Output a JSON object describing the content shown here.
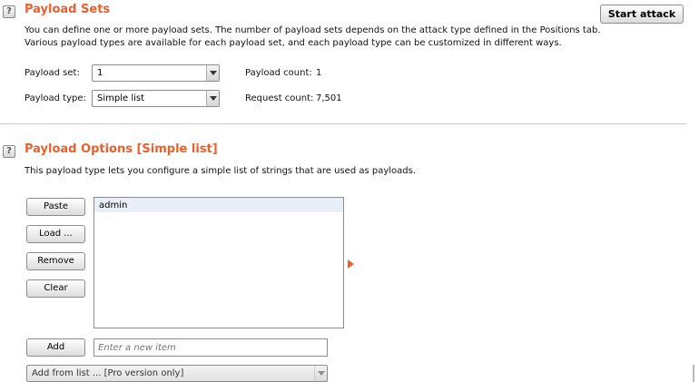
{
  "payload_sets": {
    "title": "Payload Sets",
    "start_attack_label": "Start attack",
    "description_line1": "You can define one or more payload sets. The number of payload sets depends on the attack type defined in the Positions tab.",
    "description_line2": "Various payload types are available for each payload set, and each payload type can be customized in different ways.",
    "payload_set_label": "Payload set:",
    "payload_set_value": "1",
    "payload_count_label": "Payload count:",
    "payload_count_value": "1",
    "payload_type_label": "Payload type:",
    "payload_type_value": "Simple list",
    "request_count_label": "Request count:",
    "request_count_value": "7,501"
  },
  "payload_options": {
    "title": "Payload Options [Simple list]",
    "description": "This payload type lets you configure a simple list of strings that are used as payloads.",
    "buttons": {
      "paste": "Paste",
      "load": "Load ...",
      "remove": "Remove",
      "clear": "Clear",
      "add": "Add"
    },
    "list_items": [
      "admin"
    ],
    "new_item_placeholder": "Enter a new item",
    "add_from_list_value": "Add from list ... [Pro version only]"
  },
  "help_icon_glyph": "?",
  "colors": {
    "title": "#e8602c",
    "expand_arrow": "#e8602c"
  }
}
